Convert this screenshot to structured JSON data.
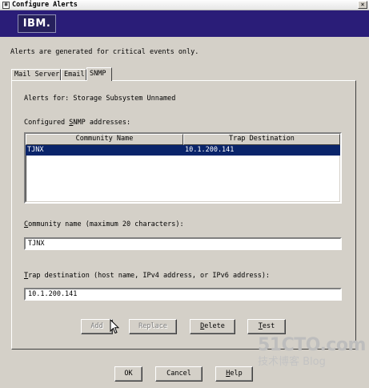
{
  "window": {
    "title": "Configure Alerts",
    "close_glyph": "×",
    "icon_glyph": "▦"
  },
  "banner": {
    "logo_text": "IBM."
  },
  "info_text": "Alerts are generated for critical events only.",
  "tabs": [
    {
      "label": "Mail Server",
      "active": false
    },
    {
      "label": "Email",
      "active": false
    },
    {
      "label": "SNMP",
      "active": true
    }
  ],
  "snmp": {
    "alerts_for": "Alerts for: Storage Subsystem Unnamed",
    "addresses_label": "Configured SNMP addresses:",
    "columns": [
      "Community Name",
      "Trap Destination"
    ],
    "rows": [
      {
        "community": "TJNX",
        "trap": "10.1.200.141",
        "selected": true
      }
    ],
    "community_label": "Community name (maximum 20 characters):",
    "community_value": "TJNX",
    "trap_label": "Trap destination (host name, IPv4 address, or IPv6 address):",
    "trap_value": "10.1.200.141",
    "buttons": {
      "add": "Add",
      "replace": "Replace",
      "delete": "Delete",
      "test": "Test"
    }
  },
  "footer": {
    "ok": "OK",
    "cancel": "Cancel",
    "help": "Help"
  },
  "watermark": {
    "main": "51CTO.com",
    "sub": "技术博客  Blog"
  },
  "colors": {
    "banner": "#2a1d78",
    "selection": "#0a246a",
    "face": "#d4d0c8"
  }
}
